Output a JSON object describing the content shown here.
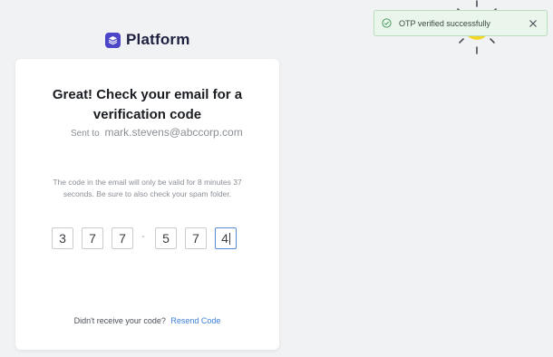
{
  "brand": {
    "name": "Platform",
    "logo_icon": "stack-icon",
    "color": "#4b46c7"
  },
  "toast": {
    "message": "OTP verified successfully",
    "status": "success"
  },
  "card": {
    "title": "Great! Check your email for a verification code",
    "sent_to_label": "Sent to",
    "email": "mark.stevens@abccorp.com",
    "notice": "The code in the email will only be valid for 8 minutes 37 seconds. Be sure to also check your spam folder.",
    "otp": {
      "digits": [
        "3",
        "7",
        "7",
        "5",
        "7",
        "4"
      ],
      "separator": "-",
      "active_index": 5
    },
    "resend_prompt": "Didn't receive your code?",
    "resend_link": "Resend Code"
  },
  "colors": {
    "accent": "#3c7fd6",
    "toast_bg": "#eaf6ec",
    "success": "#4a9a5a"
  }
}
